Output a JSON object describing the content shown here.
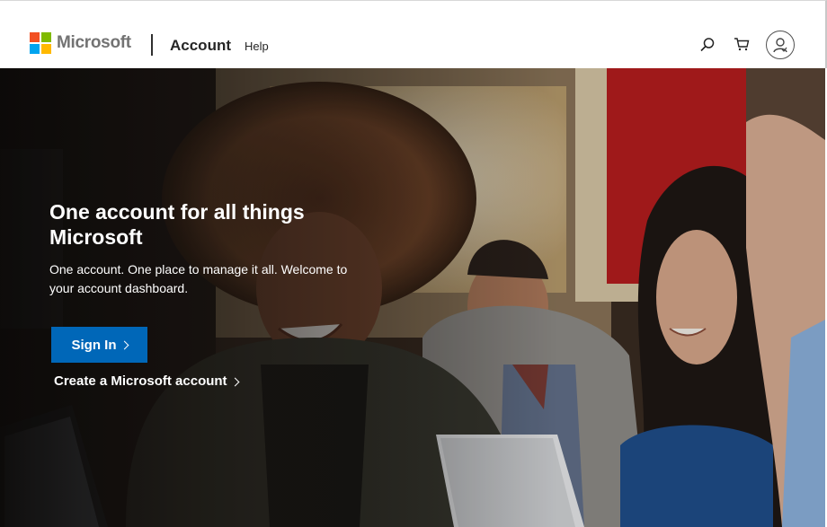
{
  "stray_char": ";",
  "brand": {
    "name": "Microsoft",
    "logo_colors": [
      "#f25022",
      "#7fba00",
      "#00a4ef",
      "#ffb900"
    ]
  },
  "header": {
    "section_title": "Account",
    "help_label": "Help",
    "icons": [
      "search-icon",
      "cart-icon",
      "user-icon"
    ]
  },
  "hero": {
    "title": "One account for all things Microsoft",
    "subtitle": "One account. One place to manage it all. Welcome to your account dashboard.",
    "signin_label": "Sign In",
    "create_label": "Create a Microsoft account",
    "accent_color": "#0067b8"
  }
}
